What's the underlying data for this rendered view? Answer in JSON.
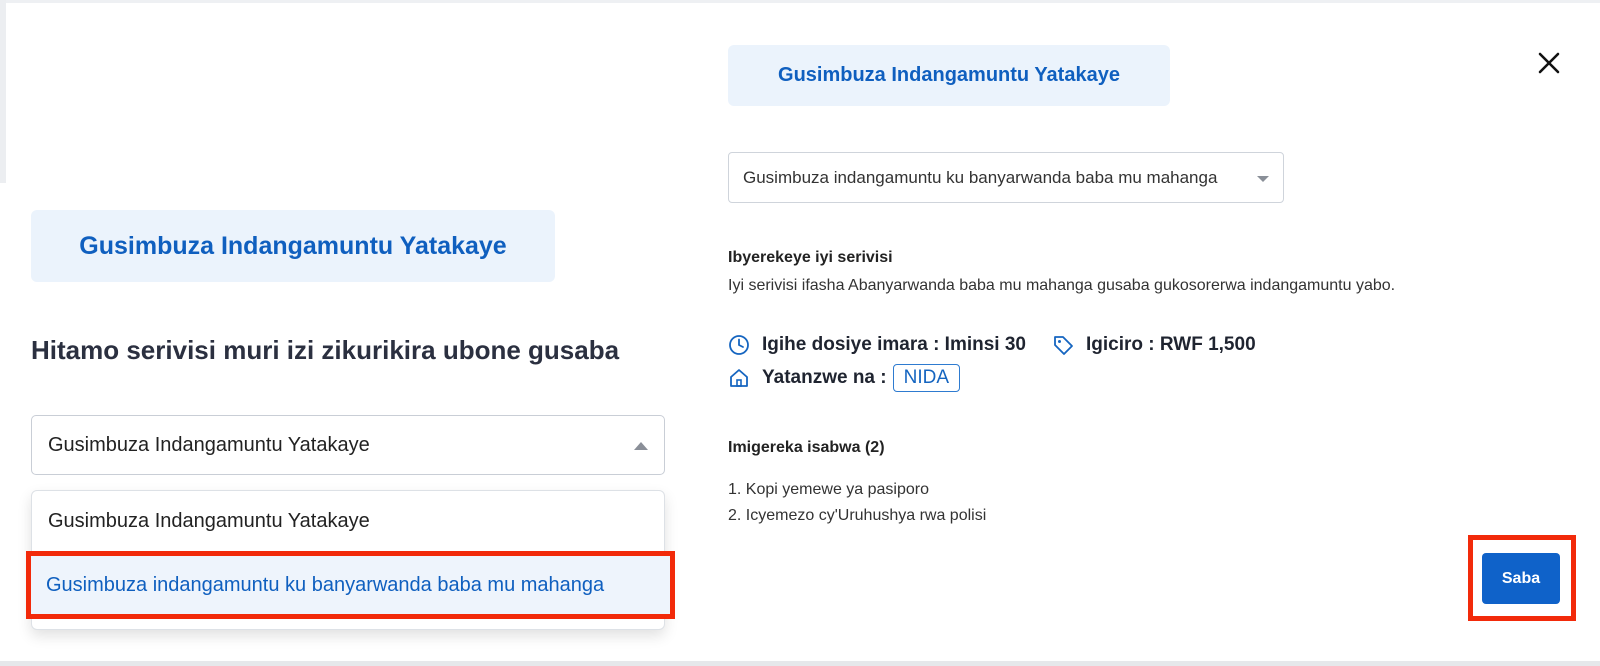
{
  "left_panel": {
    "title": "Gusimbuza Indangamuntu Yatakaye",
    "heading": "Hitamo serivisi muri izi zikurikira ubone gusaba",
    "select_value": "Gusimbuza Indangamuntu Yatakaye",
    "dropdown_options": [
      "Gusimbuza Indangamuntu Yatakaye",
      "Gusimbuza indangamuntu ku banyarwanda baba mu mahanga"
    ]
  },
  "right_panel": {
    "title": "Gusimbuza Indangamuntu Yatakaye",
    "select_value": "Gusimbuza indangamuntu ku banyarwanda baba mu mahanga",
    "info_title": "Ibyerekeye iyi serivisi",
    "info_description": "Iyi serivisi ifasha Abanyarwanda baba mu mahanga gusaba gukosorerwa indangamuntu yabo.",
    "duration": "Igihe dosiye imara : Iminsi 30",
    "price": "Igiciro : RWF 1,500",
    "provider_label": "Yatanzwe na :",
    "provider_badge": "NIDA",
    "requirements_title": "Imigereka isabwa (2)",
    "requirements": [
      "1. Kopi yemewe ya pasiporo",
      "2. Icyemezo cy'Uruhushya rwa polisi"
    ],
    "apply_button": "Saba"
  },
  "icons": {
    "close": "close-icon",
    "clock": "clock-icon",
    "tag": "tag-icon",
    "home": "home-icon"
  },
  "colors": {
    "accent": "#0f5fbf",
    "title_bg": "#ebf3fc",
    "highlight": "#f22a0a",
    "button": "#0f62c9"
  }
}
